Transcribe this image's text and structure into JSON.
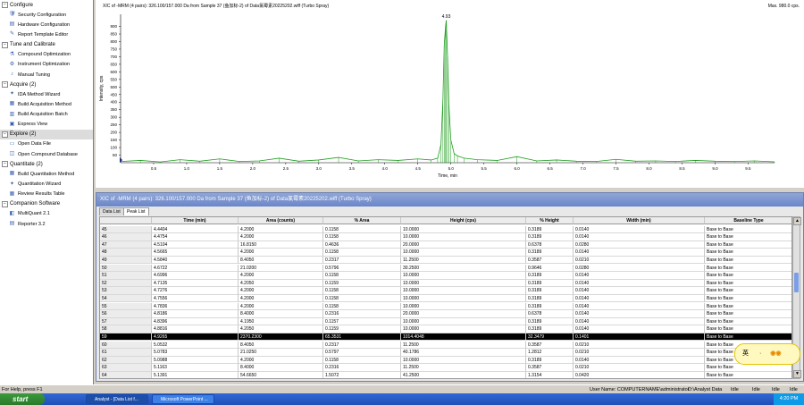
{
  "nav": {
    "groups": [
      {
        "label": "Configure",
        "expanded": true,
        "items": [
          {
            "label": "Security Configuration",
            "icon": "shield-icon"
          },
          {
            "label": "Hardware Configuration",
            "icon": "hardware-icon"
          },
          {
            "label": "Report Template Editor",
            "icon": "report-icon"
          }
        ]
      },
      {
        "label": "Tune and Calibrate",
        "expanded": true,
        "items": [
          {
            "label": "Compound Optimization",
            "icon": "compound-icon"
          },
          {
            "label": "Instrument Optimization",
            "icon": "instrument-icon"
          },
          {
            "label": "Manual Tuning",
            "icon": "tuning-icon"
          }
        ]
      },
      {
        "label": "Acquire  (2)",
        "expanded": true,
        "items": [
          {
            "label": "IDA Method Wizard",
            "icon": "wizard-icon"
          },
          {
            "label": "Build Acquisition Method",
            "icon": "method-icon"
          },
          {
            "label": "Build Acquisition Batch",
            "icon": "batch-icon"
          },
          {
            "label": "Express View",
            "icon": "express-icon"
          }
        ]
      },
      {
        "label": "Explore  (2)",
        "expanded": true,
        "selected": true,
        "items": [
          {
            "label": "Open Data File",
            "icon": "folder-icon"
          },
          {
            "label": "Open Compound Database",
            "icon": "database-icon"
          }
        ]
      },
      {
        "label": "Quantitate  (2)",
        "expanded": true,
        "items": [
          {
            "label": "Build Quantitation Method",
            "icon": "method-icon"
          },
          {
            "label": "Quantitation Wizard",
            "icon": "wizard-icon"
          },
          {
            "label": "Review Results Table",
            "icon": "table-icon"
          }
        ]
      },
      {
        "label": "Companion Software",
        "expanded": true,
        "items": [
          {
            "label": "MultiQuant 2.1",
            "icon": "multiquant-icon"
          },
          {
            "label": "Reporter 3.2",
            "icon": "reporter-icon"
          }
        ]
      }
    ]
  },
  "chart_data": {
    "type": "line",
    "title": "XIC of -MRM (4 pairs): 326.100/157.000 Da  from Sample 37 (鱼加标-2) of Data氯霉素20225202.wiff (Turbo Spray)",
    "max_label": "Max. 980.0 cps.",
    "xlabel": "Time, min",
    "ylabel": "Intensity, cps",
    "xlim": [
      0,
      9.9
    ],
    "ylim": [
      0,
      980
    ],
    "x_ticks": [
      "0.5",
      "1.0",
      "1.5",
      "2.0",
      "2.5",
      "3.0",
      "3.5",
      "4.0",
      "4.5",
      "5.0",
      "5.5",
      "6.0",
      "6.5",
      "7.0",
      "7.5",
      "8.0",
      "8.5",
      "9.0",
      "9.5"
    ],
    "y_ticks": [
      "50",
      "100",
      "150",
      "200",
      "250",
      "300",
      "350",
      "400",
      "450",
      "500",
      "550",
      "600",
      "650",
      "700",
      "750",
      "800",
      "850",
      "900"
    ],
    "peak_label": "4.93",
    "peak": {
      "x": 4.93,
      "y": 940
    },
    "series_color": "#1e9e1e",
    "series": [
      {
        "x": [
          0.0,
          0.3,
          0.6,
          0.9,
          1.2,
          1.5,
          1.8,
          2.1,
          2.4,
          2.7,
          3.0,
          3.3,
          3.6,
          3.9,
          4.2,
          4.5,
          4.7,
          4.8,
          4.85,
          4.88,
          4.9,
          4.92,
          4.93,
          4.95,
          4.97,
          5.0,
          5.05,
          5.1,
          5.2,
          5.4,
          5.7,
          6.0,
          6.3,
          6.6,
          6.9,
          7.2,
          7.5,
          7.8,
          8.1,
          8.4,
          8.7,
          9.0,
          9.3,
          9.6,
          9.9
        ],
        "y": [
          8,
          15,
          5,
          20,
          10,
          25,
          8,
          12,
          30,
          10,
          18,
          35,
          12,
          20,
          15,
          25,
          18,
          30,
          120,
          420,
          780,
          900,
          940,
          700,
          380,
          150,
          60,
          45,
          30,
          20,
          15,
          40,
          12,
          18,
          10,
          8,
          22,
          10,
          12,
          8,
          15,
          10,
          8,
          12,
          6
        ]
      }
    ]
  },
  "peaklist": {
    "title": "XIC of -MRM (4 pairs): 326.100/157.000 Da  from Sample 37 (鱼加标-2) of Data氯霉素20225202.wiff (Turbo Spray)",
    "tabs": [
      "Data List",
      "Peak List"
    ],
    "active_tab": 1,
    "columns": [
      "",
      "Time (min)",
      "Area (counts)",
      "% Area",
      "Height (cps)",
      "% Height",
      "Width (min)",
      "Baseline Type"
    ],
    "selected_row": 59,
    "rows": [
      [
        "45",
        "4.4404",
        "4.2000",
        "0.1158",
        "10.0000",
        "0.3189",
        "0.0140",
        "Base to Base"
      ],
      [
        "46",
        "4.4754",
        "4.2000",
        "0.1158",
        "10.0000",
        "0.3189",
        "0.0140",
        "Base to Base"
      ],
      [
        "47",
        "4.5104",
        "16.8150",
        "0.4636",
        "20.0000",
        "0.6378",
        "0.0280",
        "Base to Base"
      ],
      [
        "48",
        "4.5665",
        "4.2000",
        "0.1158",
        "10.0000",
        "0.3189",
        "0.0140",
        "Base to Base"
      ],
      [
        "49",
        "4.5840",
        "8.4050",
        "0.2317",
        "11.2500",
        "0.3587",
        "0.0210",
        "Base to Base"
      ],
      [
        "50",
        "4.6722",
        "21.0200",
        "0.5796",
        "30.2500",
        "0.9646",
        "0.0280",
        "Base to Base"
      ],
      [
        "51",
        "4.6996",
        "4.2000",
        "0.1158",
        "10.0000",
        "0.3189",
        "0.0140",
        "Base to Base"
      ],
      [
        "52",
        "4.7135",
        "4.2050",
        "0.1159",
        "10.0000",
        "0.3189",
        "0.0140",
        "Base to Base"
      ],
      [
        "53",
        "4.7276",
        "4.2000",
        "0.1158",
        "10.0000",
        "0.3189",
        "0.0140",
        "Base to Base"
      ],
      [
        "54",
        "4.7556",
        "4.2000",
        "0.1158",
        "10.0000",
        "0.3189",
        "0.0140",
        "Base to Base"
      ],
      [
        "55",
        "4.7836",
        "4.2000",
        "0.1158",
        "10.0000",
        "0.3189",
        "0.0140",
        "Base to Base"
      ],
      [
        "56",
        "4.8186",
        "8.4000",
        "0.2316",
        "20.0000",
        "0.6378",
        "0.0140",
        "Base to Base"
      ],
      [
        "57",
        "4.8396",
        "4.1950",
        "0.1157",
        "10.0000",
        "0.3189",
        "0.0140",
        "Base to Base"
      ],
      [
        "58",
        "4.8816",
        "4.2050",
        "0.1159",
        "10.0000",
        "0.3189",
        "0.0140",
        "Base to Base"
      ],
      [
        "59",
        "4.9265",
        "2370.2300",
        "65.3531",
        "1014.4048",
        "32.3479",
        "0.1401",
        "Base to Base"
      ],
      [
        "60",
        "5.0532",
        "8.4050",
        "0.2317",
        "11.2500",
        "0.3587",
        "0.0210",
        "Base to Base"
      ],
      [
        "61",
        "5.0783",
        "21.0250",
        "0.5797",
        "40.1786",
        "1.2812",
        "0.0210",
        "Base to Base"
      ],
      [
        "62",
        "5.0988",
        "4.2000",
        "0.1158",
        "10.0000",
        "0.3189",
        "0.0140",
        "Base to Base"
      ],
      [
        "63",
        "5.1163",
        "8.4000",
        "0.2316",
        "11.2500",
        "0.3587",
        "0.0210",
        "Base to Base"
      ],
      [
        "64",
        "5.1391",
        "54.6650",
        "1.5072",
        "41.2500",
        "1.3154",
        "0.0420",
        "Base to Base"
      ]
    ]
  },
  "status": {
    "help": "For Help, press F1",
    "user": "User Name: COMPUTERNAME\\administrator",
    "path": "D:\\Analyst Data",
    "idle1": "Idle",
    "idle2": "Idle",
    "idle3": "Idle",
    "idle4": "Idle"
  },
  "taskbar": {
    "start": "start",
    "buttons": [
      "Analyst - [Data List f...",
      "Microsoft PowerPoint ..."
    ],
    "clock": "4:20 PM"
  },
  "ime": {
    "label": "英",
    "dot": "·"
  }
}
